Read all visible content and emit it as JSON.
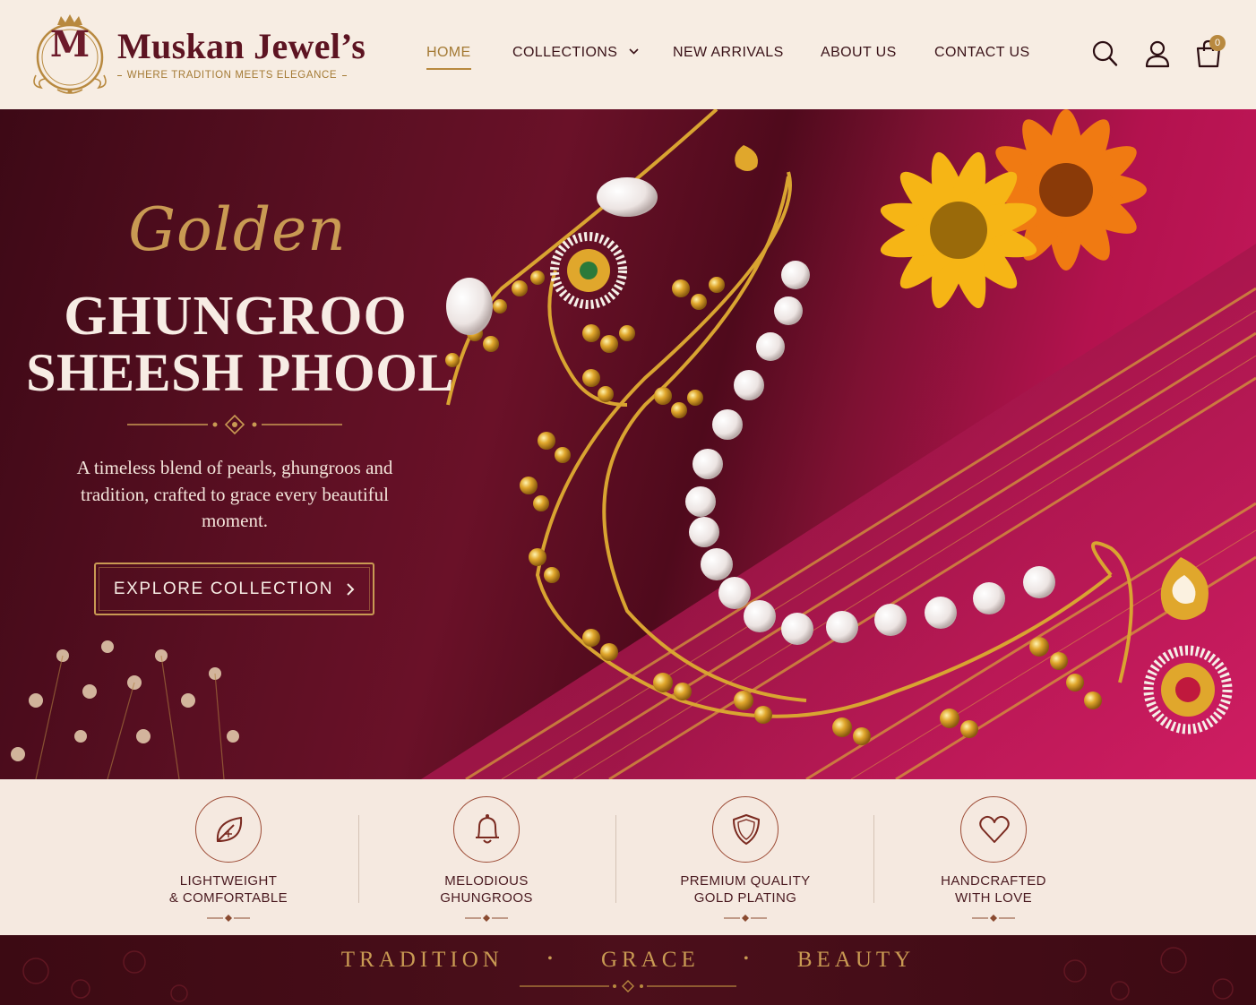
{
  "brand": {
    "logo_letter": "M",
    "name": "Muskan Jewel’s",
    "tagline": "WHERE TRADITION MEETS ELEGANCE"
  },
  "nav": {
    "home": "HOME",
    "collections": "COLLECTIONS",
    "new_arrivals": "NEW ARRIVALS",
    "about": "ABOUT US",
    "contact": "CONTACT US",
    "active": "HOME"
  },
  "header_icons": {
    "search": "search-icon",
    "account": "user-icon",
    "cart": "shopping-bag-icon",
    "cart_count": "0"
  },
  "hero": {
    "script_title": "Golden",
    "title_line1": "GHUNGROO",
    "title_line2": "SHEESH PHOOL",
    "description": "A timeless blend of pearls, ghungroos and tradition, crafted to grace every beautiful moment.",
    "cta_label": "EXPLORE COLLECTION"
  },
  "features": [
    {
      "icon": "leaf-icon",
      "line1": "LIGHTWEIGHT",
      "line2": "& COMFORTABLE"
    },
    {
      "icon": "bell-icon",
      "line1": "MELODIOUS",
      "line2": "GHUNGROOS"
    },
    {
      "icon": "shield-icon",
      "line1": "PREMIUM QUALITY",
      "line2": "GOLD PLATING"
    },
    {
      "icon": "heart-icon",
      "line1": "HANDCRAFTED",
      "line2": "WITH LOVE"
    }
  ],
  "band": {
    "word1": "TRADITION",
    "word2": "GRACE",
    "word3": "BEAUTY",
    "separator": "•"
  },
  "colors": {
    "maroon": "#5d1422",
    "gold": "#b8893f",
    "cream": "#f7ede3",
    "magenta": "#c81a5e"
  }
}
